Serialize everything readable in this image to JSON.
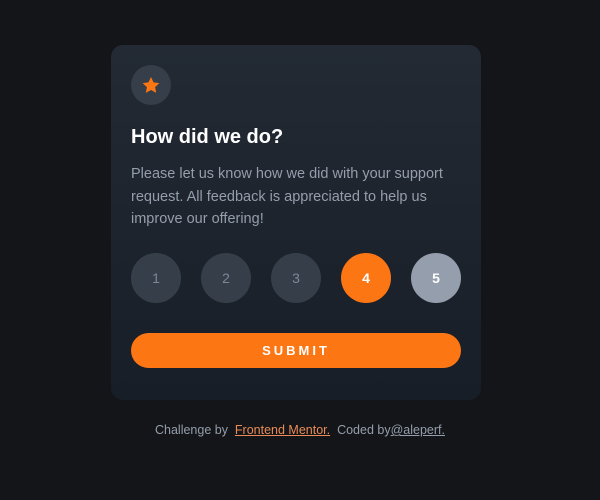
{
  "card": {
    "icon": "star-icon",
    "title": "How did we do?",
    "description": "Please let us know how we did with your support request. All feedback is appreciated to help us improve our offering!",
    "ratings": [
      "1",
      "2",
      "3",
      "4",
      "5"
    ],
    "selected_rating": "4",
    "hovered_rating": "5",
    "submit_label": "SUBMIT"
  },
  "attribution": {
    "challenge_prefix": "Challenge by",
    "challenge_link": "Frontend Mentor.",
    "coded_prefix": "Coded by",
    "author_link": "@aleperf."
  },
  "colors": {
    "background": "#131518",
    "card": "#232a34",
    "accent": "#fc7614",
    "muted": "#959eac",
    "circle": "#363e49"
  }
}
